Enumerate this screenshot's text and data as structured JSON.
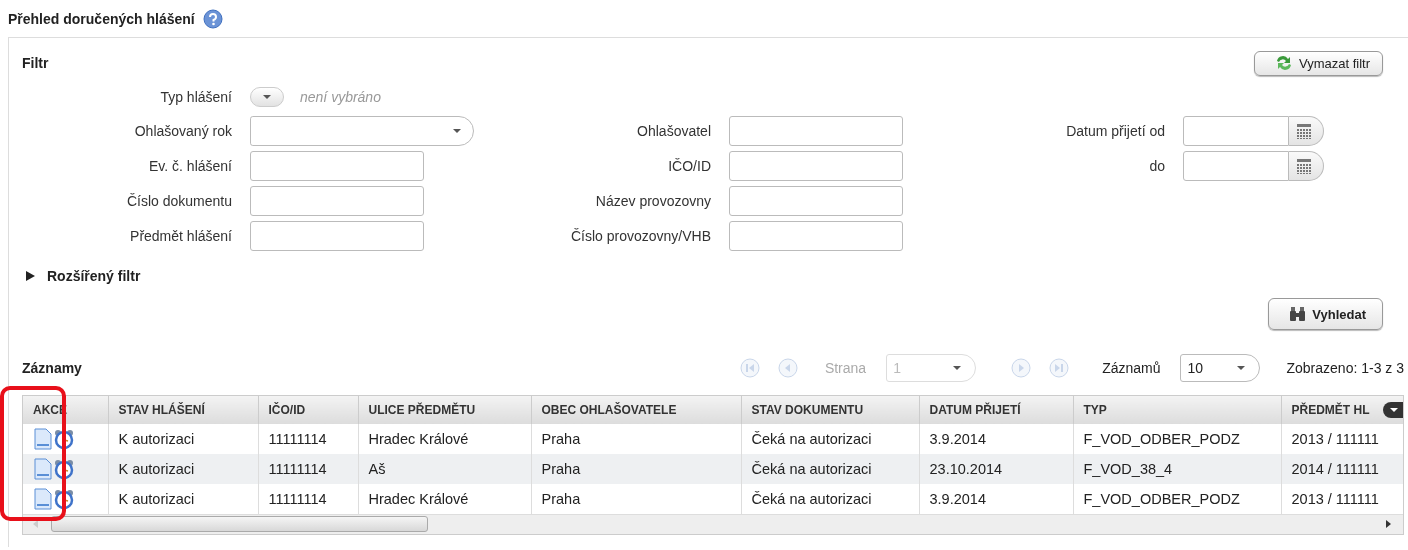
{
  "page": {
    "title": "Přehled doručených hlášení"
  },
  "filter": {
    "title": "Filtr",
    "clear_button": "Vymazat filtr",
    "type_selector": {
      "label": "Typ hlášení",
      "empty_text": "není vybráno"
    },
    "columns": [
      [
        {
          "label": "Ohlašovaný rok",
          "kind": "select"
        },
        {
          "label": "Ev. č. hlášení",
          "kind": "text"
        },
        {
          "label": "Číslo dokumentu",
          "kind": "text"
        },
        {
          "label": "Předmět hlášení",
          "kind": "text"
        }
      ],
      [
        {
          "label": "Ohlašovatel",
          "kind": "text"
        },
        {
          "label": "IČO/ID",
          "kind": "text"
        },
        {
          "label": "Název provozovny",
          "kind": "text"
        },
        {
          "label": "Číslo provozovny/VHB",
          "kind": "text"
        }
      ],
      [
        {
          "label": "Datum přijetí od",
          "kind": "date"
        },
        {
          "label": "do",
          "kind": "date"
        }
      ]
    ],
    "extended": {
      "label": "Rozšířený filtr",
      "expanded": false
    },
    "search_button": "Vyhledat"
  },
  "records": {
    "title": "Záznamy",
    "pager": {
      "page_label": "Strana",
      "page": "1",
      "disabled": true,
      "count_label": "Záznamů",
      "page_size": "10",
      "summary": "Zobrazeno: 1-3 z 3"
    },
    "columns": [
      "AKCE",
      "STAV HLÁŠENÍ",
      "IČO/ID",
      "ULICE PŘEDMĚTU",
      "OBEC OHLAŠOVATELE",
      "STAV DOKUMENTU",
      "DATUM PŘIJETÍ",
      "TYP",
      "PŘEDMĚT HL"
    ],
    "rows": [
      [
        "",
        "K autorizaci",
        "11111114",
        "Hradec Králové",
        "Praha",
        "Čeká na autorizaci",
        "3.9.2014",
        "F_VOD_ODBER_PODZ",
        "2013 / 111111"
      ],
      [
        "",
        "K autorizaci",
        "11111114",
        "Aš",
        "Praha",
        "Čeká na autorizaci",
        "23.10.2014",
        "F_VOD_38_4",
        "2014 / 111111"
      ],
      [
        "",
        "K autorizaci",
        "11111114",
        "Hradec Králové",
        "Praha",
        "Čeká na autorizaci",
        "3.9.2014",
        "F_VOD_ODBER_PODZ",
        "2013 / 111111"
      ]
    ]
  },
  "annotation": {
    "kind": "highlight-frame"
  }
}
